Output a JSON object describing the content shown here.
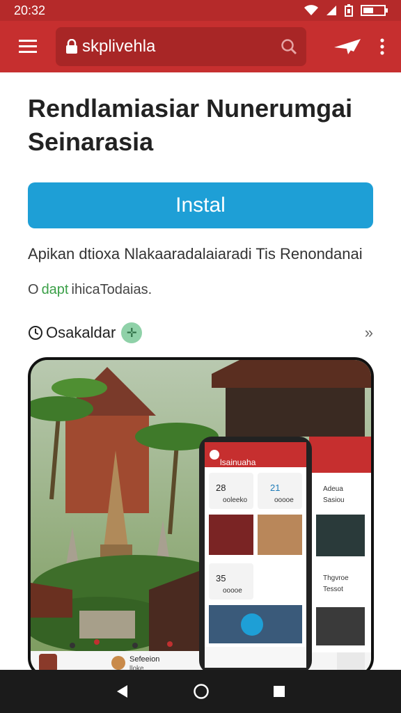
{
  "status": {
    "time": "20:32"
  },
  "appbar": {
    "search_text": "skplivehla"
  },
  "app": {
    "title": "Rendlamiasiar Nunerumgai Seinarasia",
    "install_label": "Instal",
    "description": "Apikan dtioxa Nlakaaradalaiaradi Tis Renondanai",
    "tag_prefix": "O",
    "tag_green": "dapt",
    "tag_rest": "ihicaTodaias."
  },
  "section": {
    "label": "Osakaldar",
    "prefix": ""
  },
  "phone_mock": {
    "title": "lsainuaha",
    "stats": [
      {
        "value": "28",
        "label": "ooleeko"
      },
      {
        "value": "21",
        "label": "ooooe"
      },
      {
        "value": "35",
        "label": "ooooe"
      }
    ],
    "side_labels": [
      "Adeua",
      "Sasiou",
      "Thgvroe",
      "Tessot"
    ],
    "bottom_label": "Sefeeion",
    "bottom_sub": "lloke"
  }
}
